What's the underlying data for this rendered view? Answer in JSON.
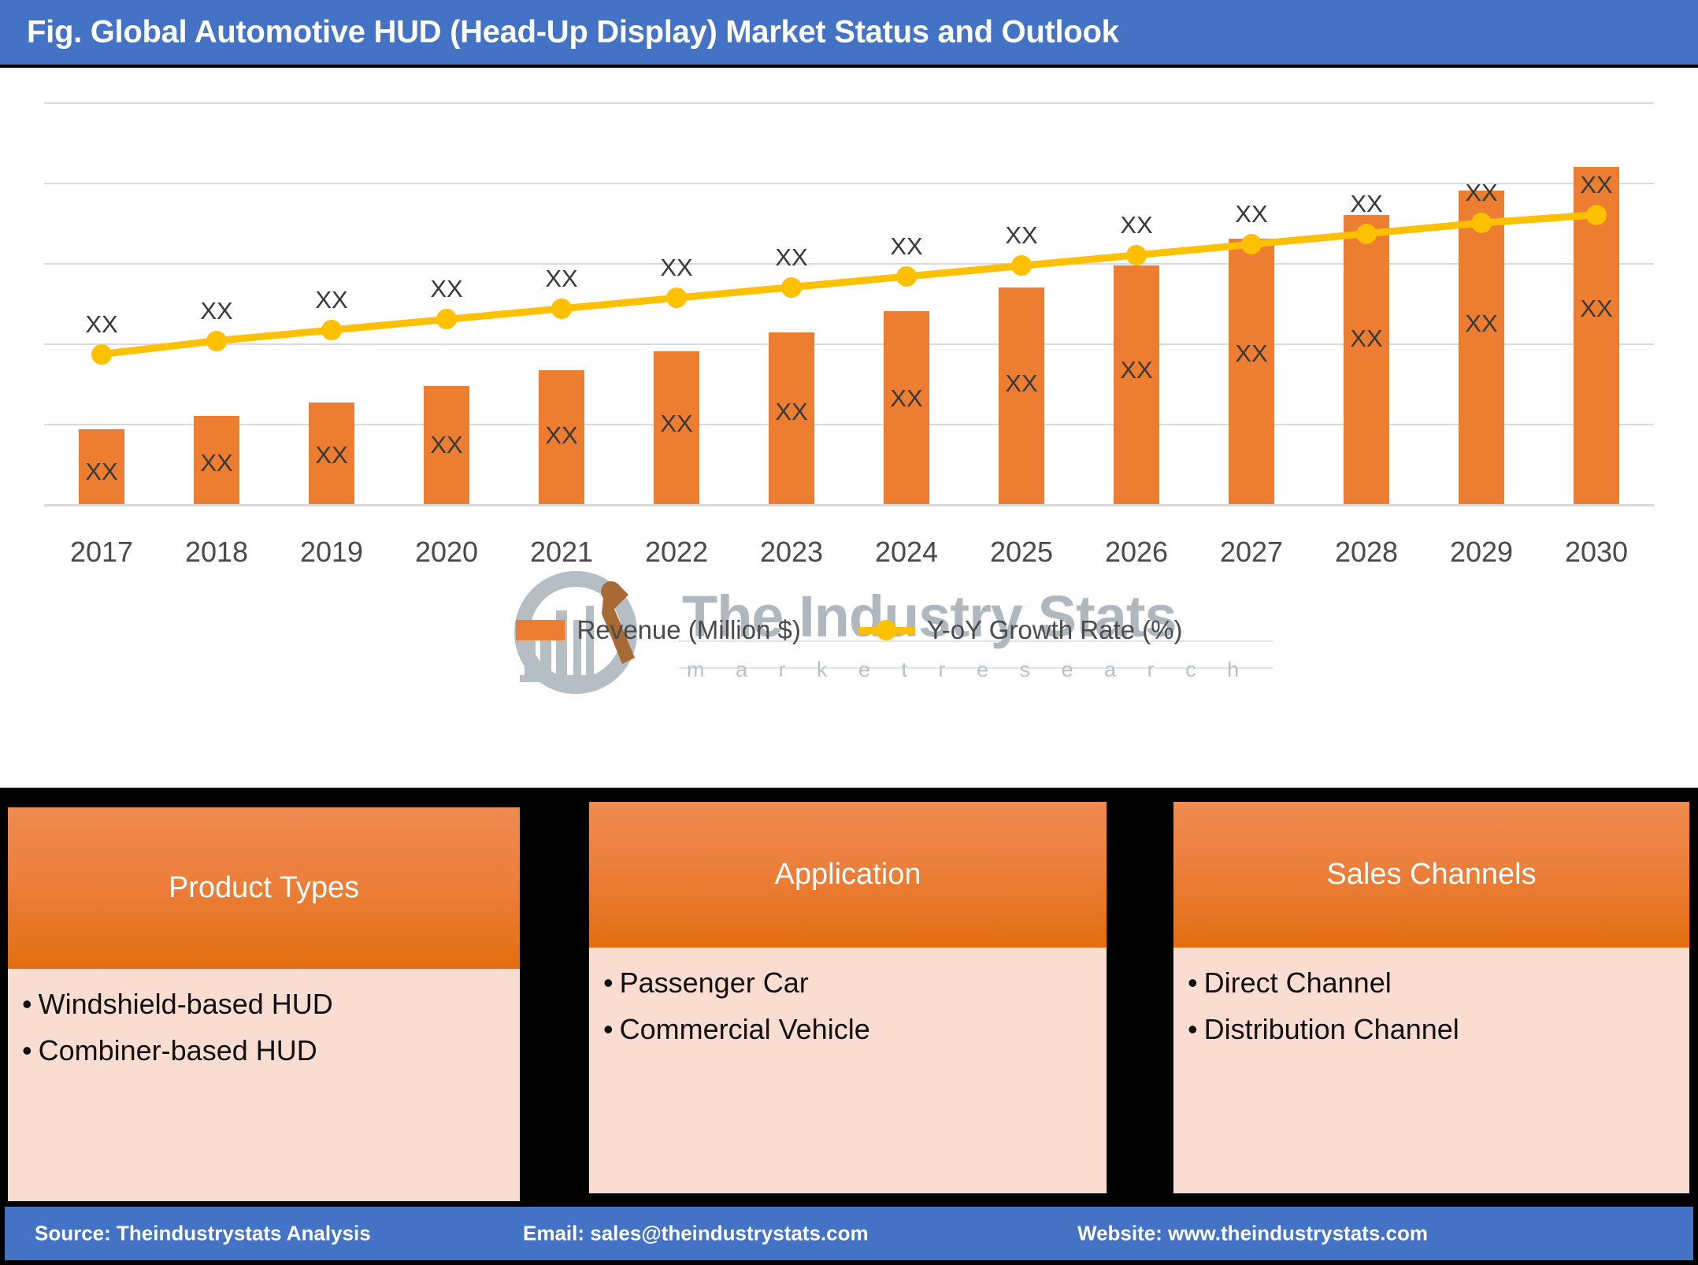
{
  "header": {
    "title": "Fig. Global Automotive HUD (Head-Up Display) Market Status and Outlook"
  },
  "watermark": {
    "brand": "The Industry Stats",
    "tagline": "m a r k e t   r e s e a r c h"
  },
  "chart_data": {
    "type": "bar",
    "title": "Fig. Global Automotive HUD (Head-Up Display) Market Status and Outlook",
    "xlabel": "",
    "ylabel": "",
    "grid": true,
    "legend_position": "bottom",
    "axis_tick_labels_hidden": true,
    "categories": [
      "2017",
      "2018",
      "2019",
      "2020",
      "2021",
      "2022",
      "2023",
      "2024",
      "2025",
      "2026",
      "2027",
      "2028",
      "2029",
      "2030"
    ],
    "series": [
      {
        "name": "Revenue (Million $)",
        "type": "bar",
        "color": "#ED7D31",
        "values": [
          28,
          33,
          38,
          44,
          50,
          57,
          64,
          72,
          81,
          89,
          99,
          108,
          117,
          126
        ],
        "data_labels": [
          "XX",
          "XX",
          "XX",
          "XX",
          "XX",
          "XX",
          "XX",
          "XX",
          "XX",
          "XX",
          "XX",
          "XX",
          "XX",
          "XX"
        ]
      },
      {
        "name": "Y-oY Growth Rate (%)",
        "type": "line",
        "color": "#FFC000",
        "values": [
          56,
          61,
          65,
          69,
          73,
          77,
          81,
          85,
          89,
          93,
          97,
          101,
          105,
          108
        ],
        "data_labels": [
          "XX",
          "XX",
          "XX",
          "XX",
          "XX",
          "XX",
          "XX",
          "XX",
          "XX",
          "XX",
          "XX",
          "XX",
          "XX",
          "XX"
        ]
      }
    ],
    "ylim": [
      0,
      150
    ],
    "gridline_count": 6
  },
  "legend": [
    {
      "label": "Revenue (Million $)",
      "marker": "square",
      "color": "#ED7D31"
    },
    {
      "label": "Y-oY Growth Rate (%)",
      "marker": "line-dot",
      "color": "#FFC000"
    }
  ],
  "panels": [
    {
      "title": "Product Types",
      "items": [
        "Windshield-based HUD",
        "Combiner-based HUD"
      ]
    },
    {
      "title": "Application",
      "items": [
        "Passenger Car",
        "Commercial Vehicle"
      ]
    },
    {
      "title": "Sales Channels",
      "items": [
        "Direct Channel",
        "Distribution Channel"
      ]
    }
  ],
  "footer": {
    "source": "Source: Theindustrystats Analysis",
    "email": "Email: sales@theindustrystats.com",
    "website": "Website: www.theindustrystats.com"
  },
  "colors": {
    "header_blue": "#4472C4",
    "bar_orange": "#ED7D31",
    "line_yellow": "#FFC000",
    "panel_body": "#F8DDD0",
    "panel_head_top": "#F08A4F",
    "panel_head_bottom": "#E26E0E",
    "grid": "#D9D9D9",
    "band_black": "#000000"
  }
}
